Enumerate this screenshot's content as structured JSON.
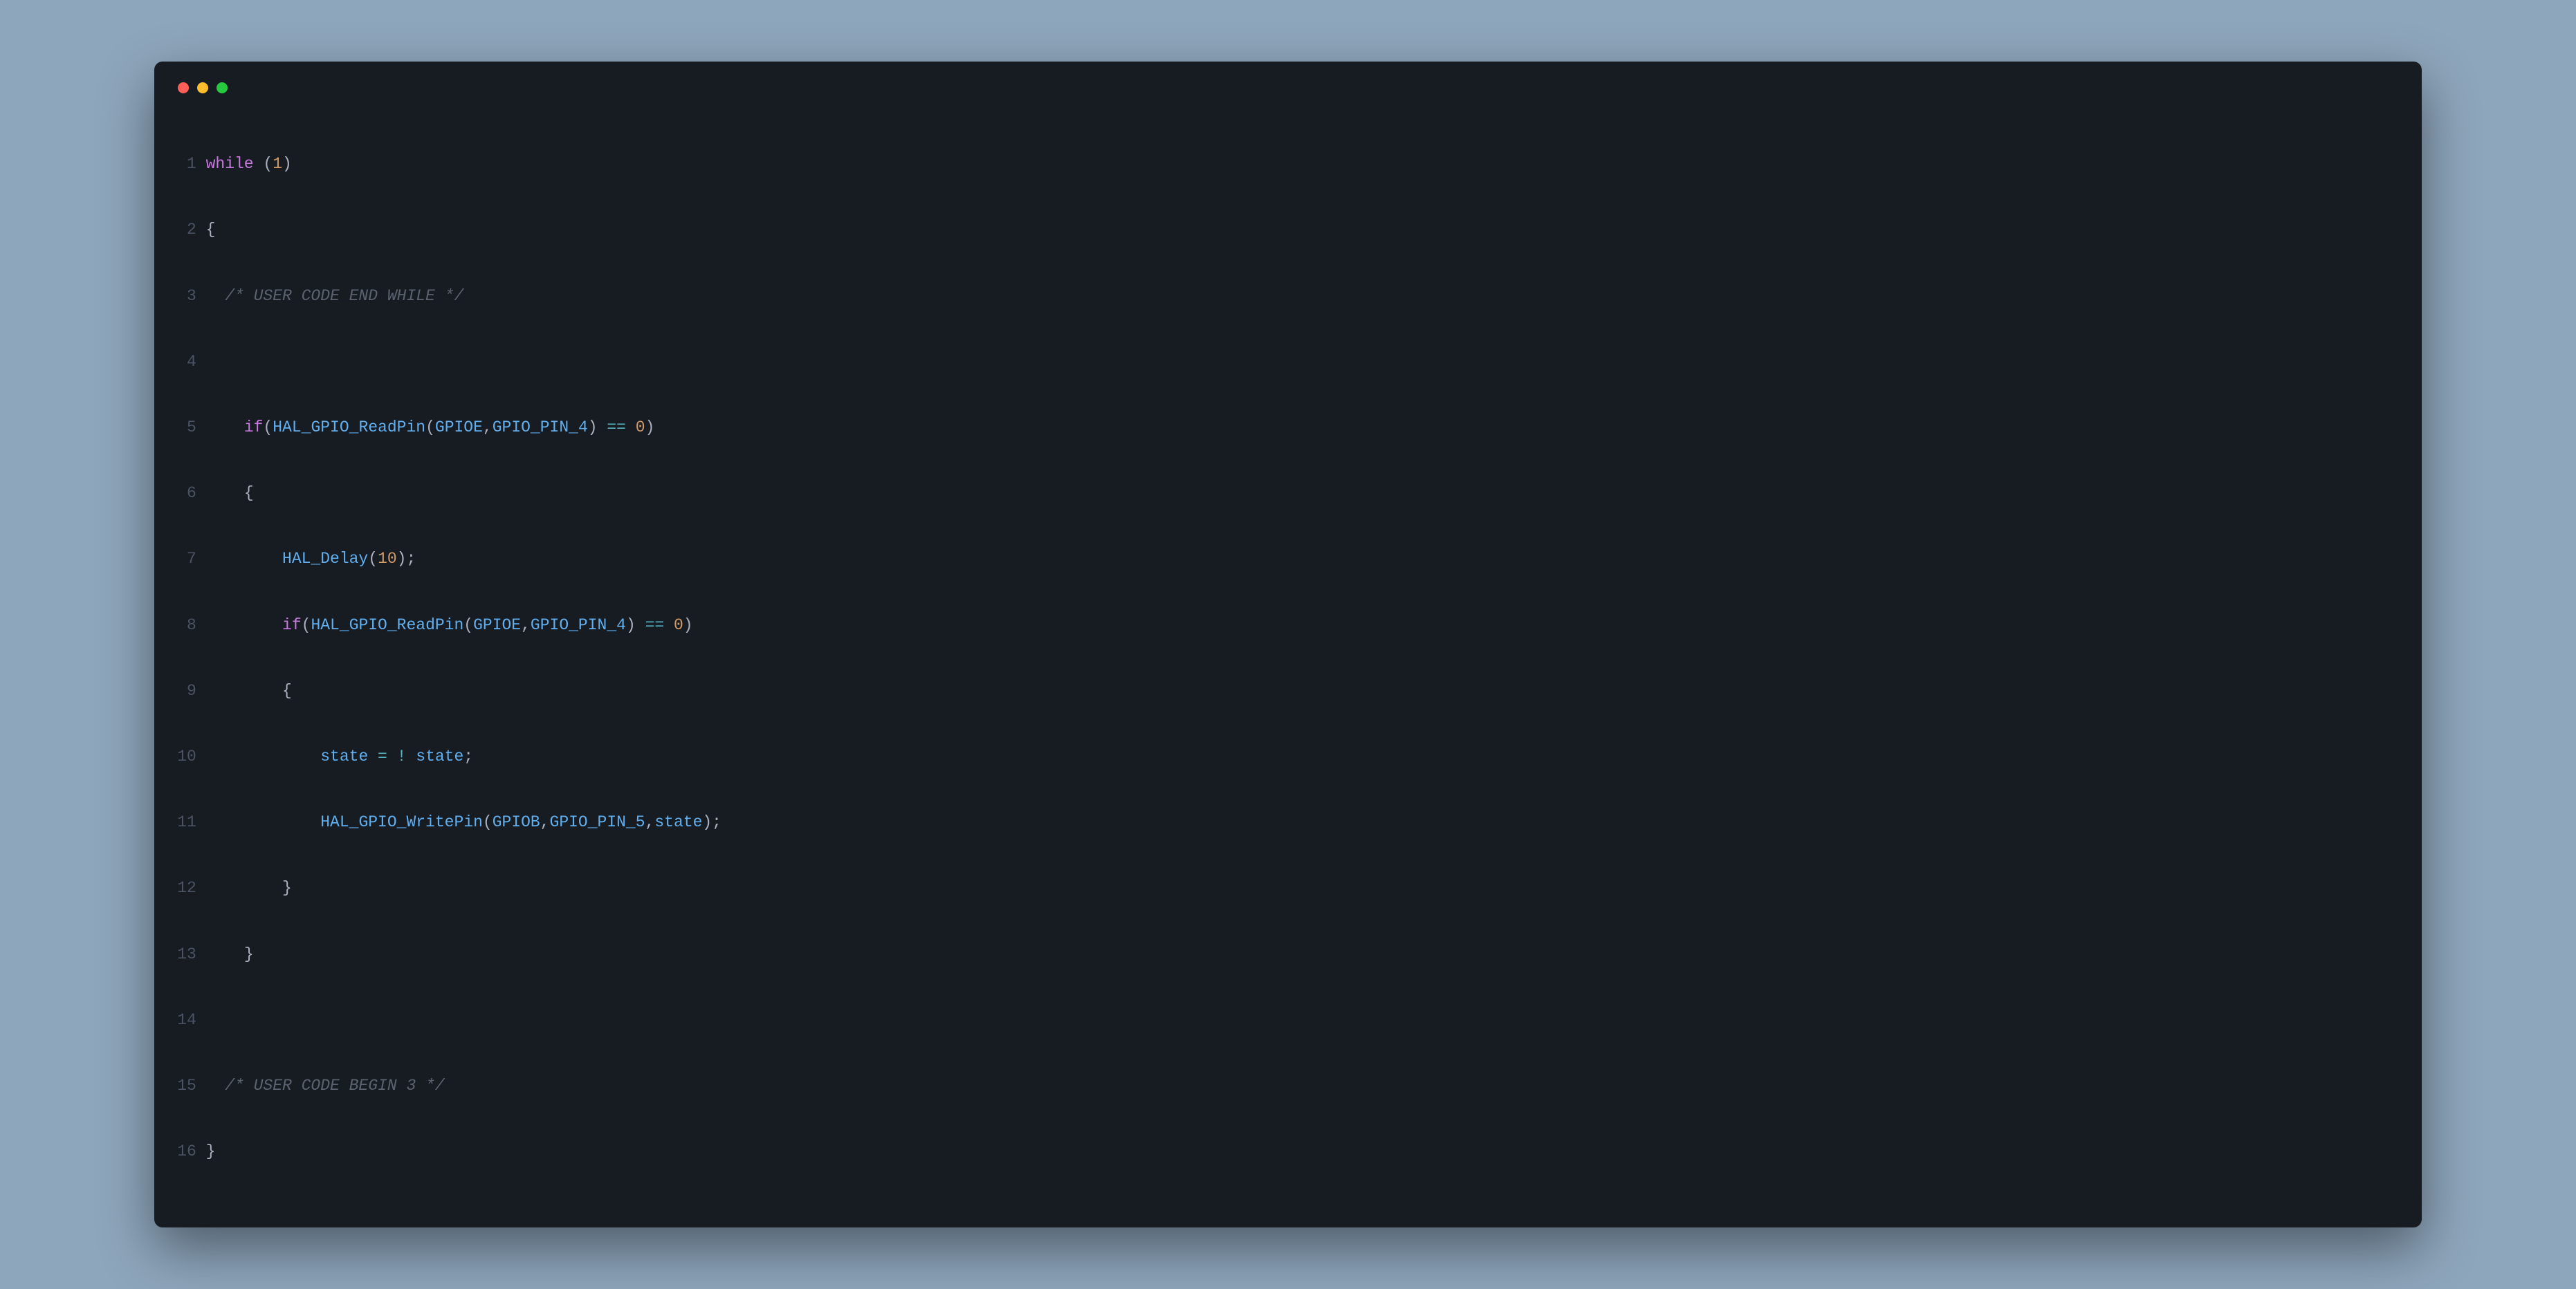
{
  "code": {
    "lines": [
      {
        "num": "1"
      },
      {
        "num": "2"
      },
      {
        "num": "3"
      },
      {
        "num": "4"
      },
      {
        "num": "5"
      },
      {
        "num": "6"
      },
      {
        "num": "7"
      },
      {
        "num": "8"
      },
      {
        "num": "9"
      },
      {
        "num": "10"
      },
      {
        "num": "11"
      },
      {
        "num": "12"
      },
      {
        "num": "13"
      },
      {
        "num": "14"
      },
      {
        "num": "15"
      },
      {
        "num": "16"
      }
    ],
    "tok": {
      "kw_while": "while",
      "kw_if_a": "if",
      "kw_if_b": "if",
      "paren_o1": " (",
      "paren_c1": ")",
      "one": "1",
      "brace_o1": "{",
      "brace_o2": "{",
      "brace_o3": "{",
      "brace_c1": "}",
      "brace_c2": "}",
      "brace_c3": "}",
      "brace_c4": "}",
      "cmt1": "  /* USER CODE END WHILE */",
      "cmt2": "  /* USER CODE BEGIN 3 */",
      "indent1": "    ",
      "indent2": "        ",
      "indent3": "            ",
      "read_a": "HAL_GPIO_ReadPin",
      "read_b": "HAL_GPIO_ReadPin",
      "delay": "HAL_Delay",
      "write": "HAL_GPIO_WritePin",
      "gpioe_a": "GPIOE",
      "gpioe_b": "GPIOE",
      "gpiob": "GPIOB",
      "pin4_a": "GPIO_PIN_4",
      "pin4_b": "GPIO_PIN_4",
      "pin5": "GPIO_PIN_5",
      "ten": "10",
      "zero_a": "0",
      "zero_b": "0",
      "eq_a": " == ",
      "eq_b": " == ",
      "open_a": "(",
      "close_a": ")",
      "open_b": "(",
      "close_b": ")",
      "open_c": "(",
      "close_c": ");",
      "open_d": "(",
      "close_d": ");",
      "comma_a": ",",
      "comma_b": ",",
      "comma_c": ",",
      "comma_d": ",",
      "state1": "state",
      "state2": "state",
      "state3": "state",
      "assign": " = ! ",
      "semi": ";"
    }
  }
}
